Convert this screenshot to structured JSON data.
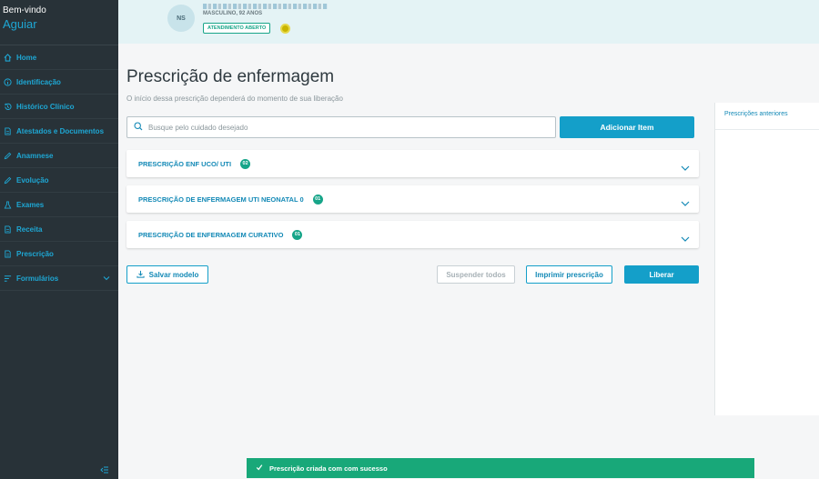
{
  "sidebar": {
    "welcome": "Bem-vindo",
    "user": "Aguiar",
    "items": [
      {
        "label": "Home",
        "icon": "home-icon"
      },
      {
        "label": "Identificação",
        "icon": "info-icon"
      },
      {
        "label": "Histórico Clínico",
        "icon": "history-icon"
      },
      {
        "label": "Atestados e Documentos",
        "icon": "document-icon"
      },
      {
        "label": "Anamnese",
        "icon": "pencil-icon"
      },
      {
        "label": "Evolução",
        "icon": "pencil-icon"
      },
      {
        "label": "Exames",
        "icon": "flask-icon"
      },
      {
        "label": "Receita",
        "icon": "document-icon"
      },
      {
        "label": "Prescrição",
        "icon": "document-icon"
      },
      {
        "label": "Formulários",
        "icon": "list-icon"
      }
    ]
  },
  "patient": {
    "initials": "NS",
    "info": "MASCULINO, 92 ANOS",
    "status_badge": "ATENDIMENTO ABERTO"
  },
  "main": {
    "title": "Prescrição de enfermagem",
    "subtitle": "O início dessa prescrição dependerá do momento de sua liberação",
    "search_placeholder": "Busque pelo cuidado desejado",
    "add_button": "Adicionar Item",
    "sections": [
      {
        "label": "PRESCRIÇÃO ENF UCO/ UTI",
        "count": "02"
      },
      {
        "label": "PRESCRIÇÃO DE ENFERMAGEM UTI NEONATAL 0",
        "count": "01"
      },
      {
        "label": "PRESCRIÇÃO DE ENFERMAGEM CURATIVO",
        "count": "01"
      }
    ],
    "save_model": "Salvar modelo",
    "suspend_all": "Suspender todos",
    "print": "Imprimir prescrição",
    "release": "Liberar"
  },
  "panel": {
    "title": "Prescrições anteriores"
  },
  "toast": {
    "message": "Prescrição criada com com sucesso"
  },
  "colors": {
    "sidebar_bg": "#283238",
    "accent": "#149fc9",
    "success": "#18a879",
    "header_bg": "#e4f3f5"
  }
}
